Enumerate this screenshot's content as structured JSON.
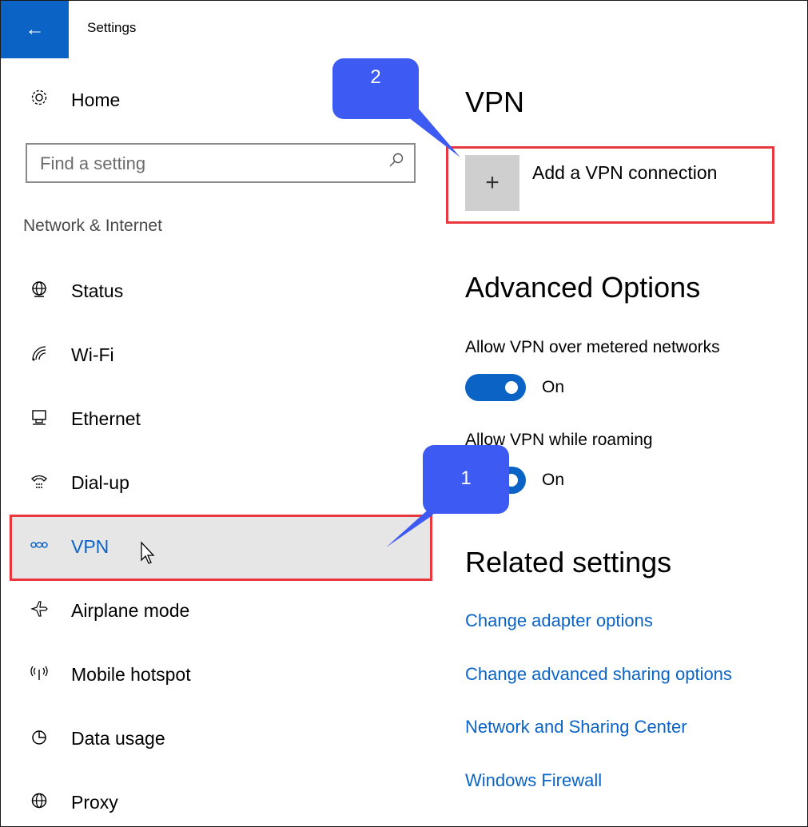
{
  "window": {
    "title": "Settings",
    "back_glyph": "←"
  },
  "sidebar": {
    "home_label": "Home",
    "search_placeholder": "Find a setting",
    "section_heading": "Network & Internet",
    "items": [
      {
        "label": "Status",
        "icon": "globe-network-icon",
        "glyph": "🌐"
      },
      {
        "label": "Wi-Fi",
        "icon": "wifi-icon",
        "glyph": "◔"
      },
      {
        "label": "Ethernet",
        "icon": "ethernet-icon",
        "glyph": "🖳"
      },
      {
        "label": "Dial-up",
        "icon": "dialup-icon",
        "glyph": "☏"
      },
      {
        "label": "VPN",
        "icon": "vpn-icon",
        "glyph": "∞",
        "selected": true
      },
      {
        "label": "Airplane mode",
        "icon": "airplane-icon",
        "glyph": "✈"
      },
      {
        "label": "Mobile hotspot",
        "icon": "hotspot-icon",
        "glyph": "((ı))"
      },
      {
        "label": "Data usage",
        "icon": "data-usage-icon",
        "glyph": "◷"
      },
      {
        "label": "Proxy",
        "icon": "proxy-globe-icon",
        "glyph": "⊕"
      }
    ]
  },
  "main": {
    "vpn_heading": "VPN",
    "add_vpn_label": "Add a VPN connection",
    "plus_glyph": "+",
    "advanced_heading": "Advanced Options",
    "options": [
      {
        "label": "Allow VPN over metered networks",
        "state": "On",
        "on": true
      },
      {
        "label": "Allow VPN while roaming",
        "state": "On",
        "on": true
      }
    ],
    "related_heading": "Related settings",
    "links": [
      "Change adapter options",
      "Change advanced sharing options",
      "Network and Sharing Center",
      "Windows Firewall"
    ]
  },
  "annotations": {
    "callout_1": "1",
    "callout_2": "2"
  },
  "colors": {
    "accent": "#0b63c6",
    "highlight": "#e8373d",
    "callout": "#3d5bf2"
  }
}
